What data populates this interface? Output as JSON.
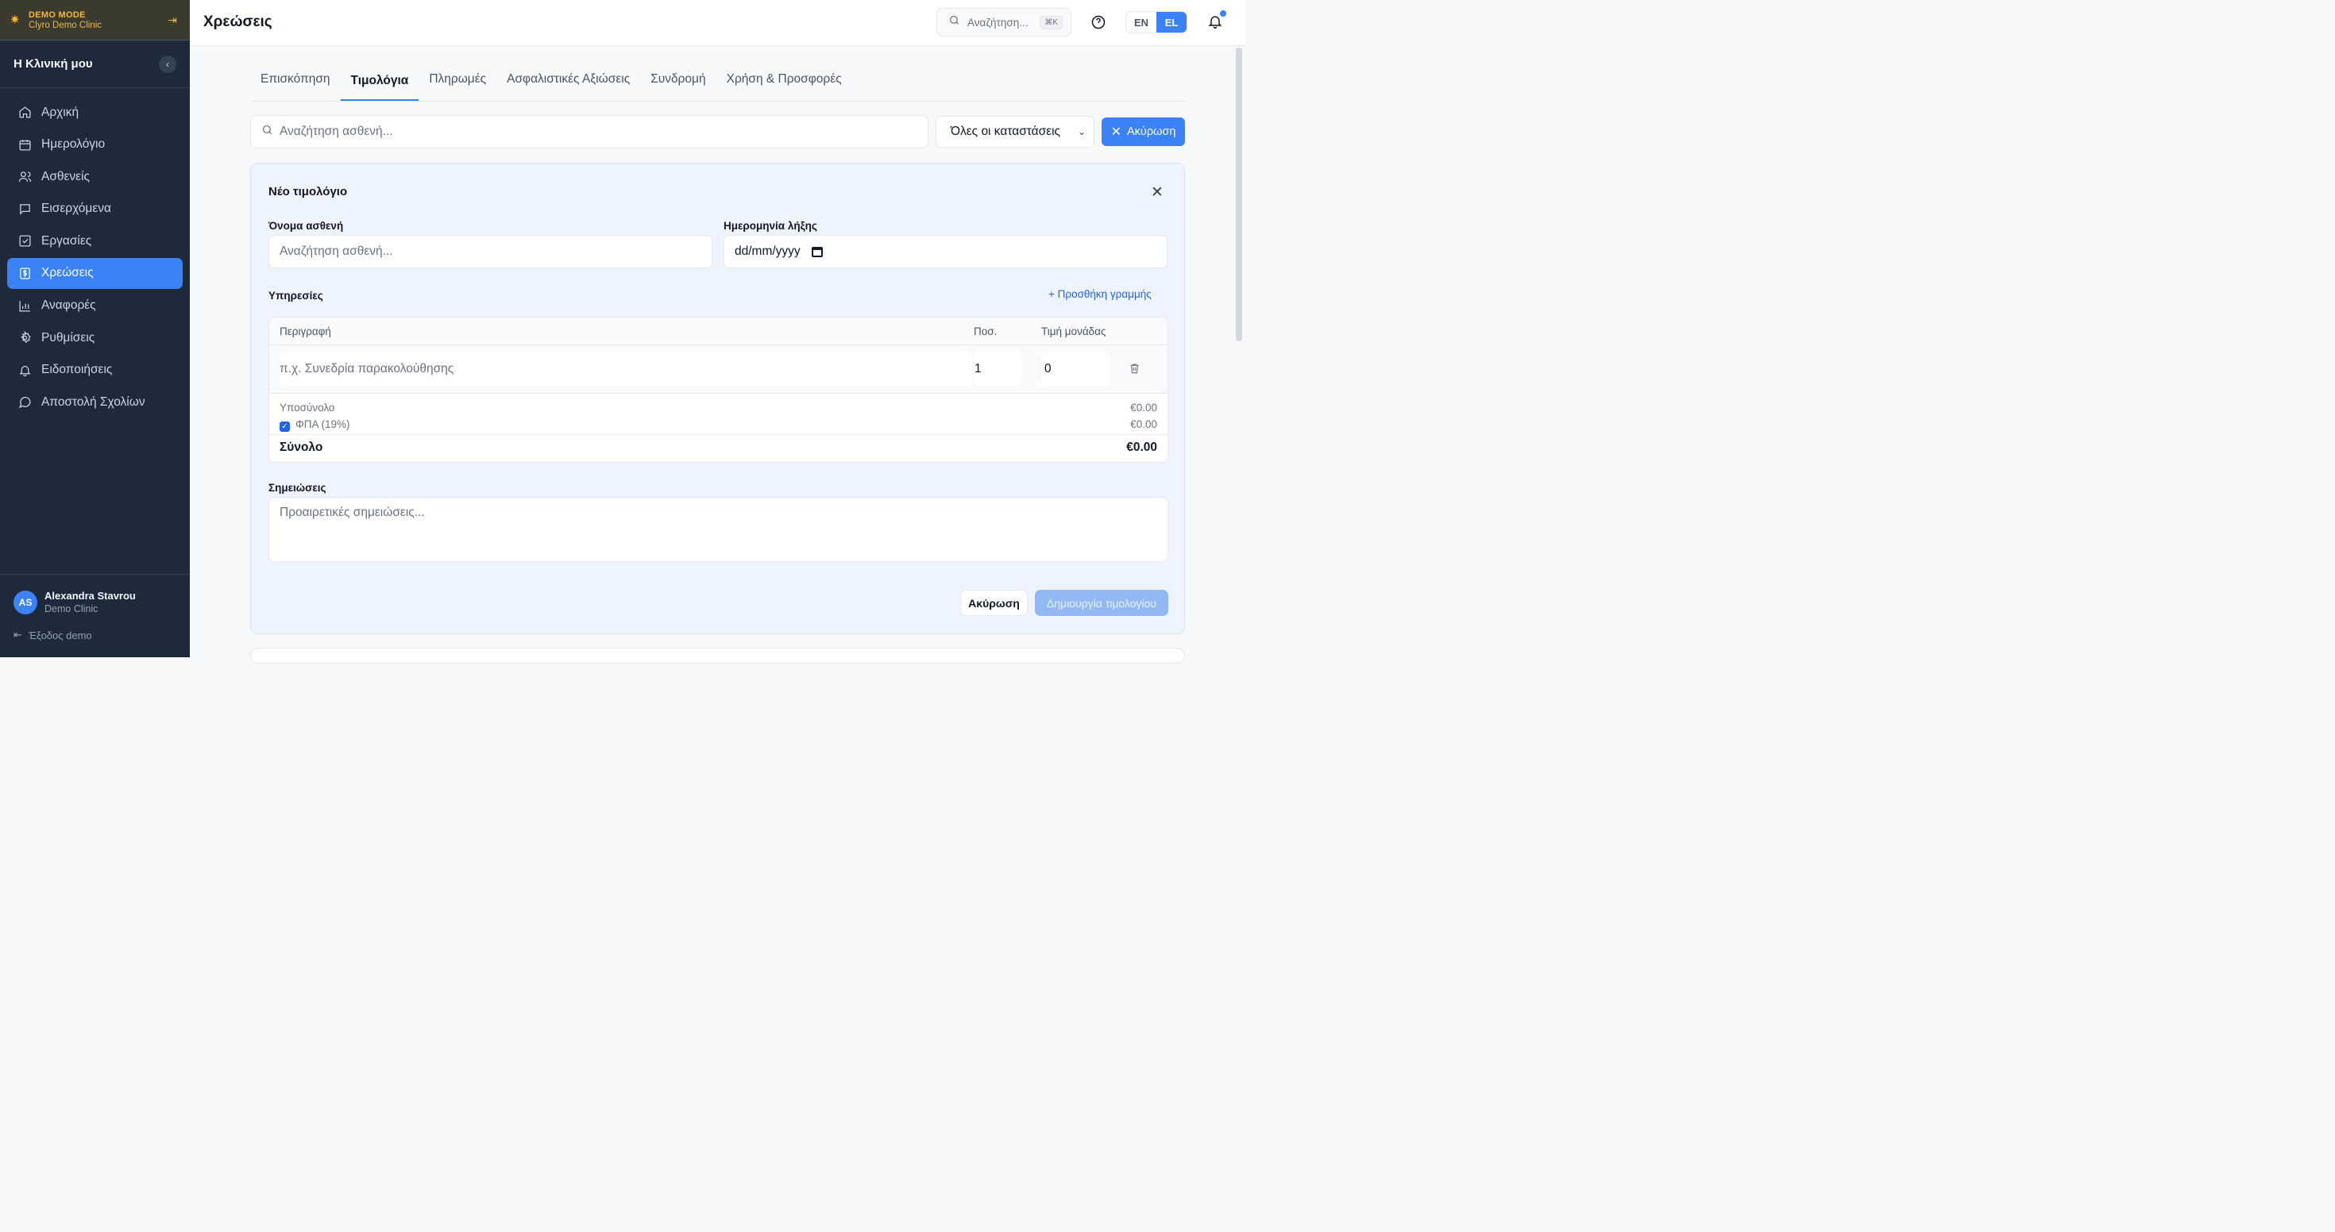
{
  "demo": {
    "mode_label": "DEMO MODE",
    "clinic": "Clyro Demo Clinic"
  },
  "sidebar": {
    "clinic_name": "Η Κλινική μου",
    "items": [
      {
        "label": "Αρχική",
        "icon": "home-icon"
      },
      {
        "label": "Ημερολόγιο",
        "icon": "calendar-icon"
      },
      {
        "label": "Ασθενείς",
        "icon": "users-icon"
      },
      {
        "label": "Εισερχόμενα",
        "icon": "message-square-icon"
      },
      {
        "label": "Εργασίες",
        "icon": "check-square-icon"
      },
      {
        "label": "Χρεώσεις",
        "icon": "dollar-receipt-icon",
        "active": true
      },
      {
        "label": "Αναφορές",
        "icon": "bar-chart-icon"
      },
      {
        "label": "Ρυθμίσεις",
        "icon": "settings-icon"
      },
      {
        "label": "Ειδοποιήσεις",
        "icon": "bell-icon"
      },
      {
        "label": "Αποστολή Σχολίων",
        "icon": "message-circle-icon"
      }
    ],
    "user": {
      "initials": "AS",
      "name": "Alexandra Stavrou",
      "clinic": "Demo Clinic"
    },
    "exit_label": "Έξοδος demo"
  },
  "header": {
    "title": "Χρεώσεις",
    "search_placeholder": "Αναζήτηση...",
    "shortcut": "⌘K",
    "languages": [
      "EN",
      "EL"
    ],
    "active_language": "EL"
  },
  "tabs": [
    {
      "label": "Επισκόπηση"
    },
    {
      "label": "Τιμολόγια",
      "active": true
    },
    {
      "label": "Πληρωμές"
    },
    {
      "label": "Ασφαλιστικές Αξιώσεις"
    },
    {
      "label": "Συνδρομή"
    },
    {
      "label": "Χρήση & Προσφορές"
    }
  ],
  "filters": {
    "search_placeholder": "Αναζήτηση ασθενή...",
    "status_value": "Όλες οι καταστάσεις",
    "cancel_label": "Ακύρωση"
  },
  "new_invoice": {
    "title": "Νέο τιμολόγιο",
    "patient_label": "Όνομα ασθενή",
    "patient_placeholder": "Αναζήτηση ασθενή...",
    "due_label": "Ημερομηνία λήξης",
    "due_value": "dd/mm/yyyy",
    "services_label": "Υπηρεσίες",
    "add_line_label": "+ Προσθήκη γραμμής",
    "columns": {
      "description": "Περιγραφή",
      "qty": "Ποσ.",
      "unit_price": "Τιμή μονάδας"
    },
    "line": {
      "description_placeholder": "π.χ. Συνεδρία παρακολούθησης",
      "qty": "1",
      "unit_price": "0"
    },
    "subtotal_label": "Υποσύνολο",
    "subtotal_value": "€0.00",
    "vat_label": "ΦΠΑ (19%)",
    "vat_checked": true,
    "vat_value": "€0.00",
    "total_label": "Σύνολο",
    "total_value": "€0.00",
    "notes_label": "Σημειώσεις",
    "notes_placeholder": "Προαιρετικές σημειώσεις...",
    "cancel_label": "Ακύρωση",
    "create_label": "Δημιουργία τιμολογίου"
  },
  "colors": {
    "accent": "#3b82f6",
    "sidebar_bg": "#1e293b",
    "demo_accent": "#f5b82e",
    "card_bg": "#eef4fd"
  }
}
